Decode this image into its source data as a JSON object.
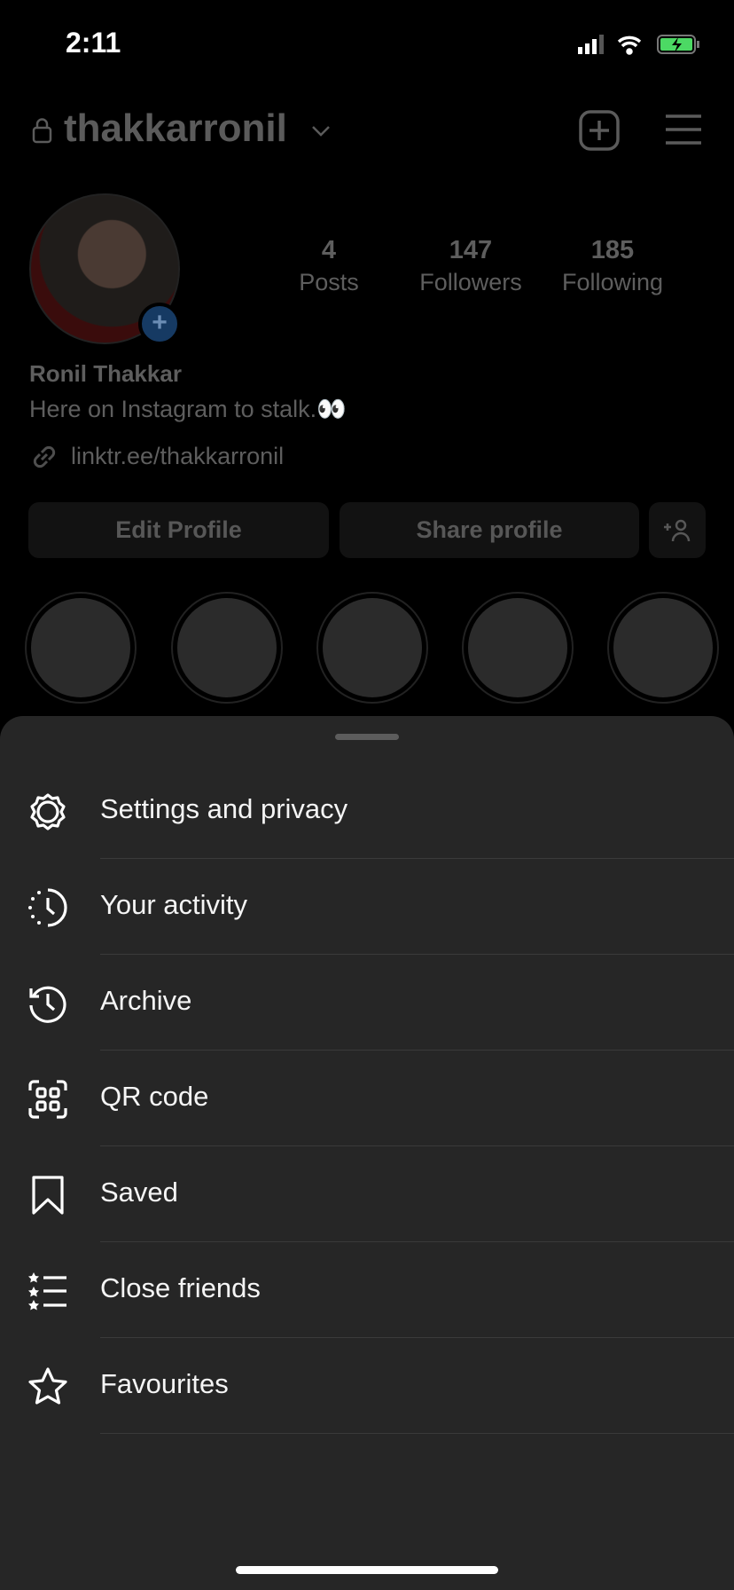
{
  "status_bar": {
    "time": "2:11"
  },
  "header": {
    "username": "thakkarronil"
  },
  "profile": {
    "stats": [
      {
        "value": "4",
        "label": "Posts"
      },
      {
        "value": "147",
        "label": "Followers"
      },
      {
        "value": "185",
        "label": "Following"
      }
    ],
    "name": "Ronil Thakkar",
    "bio": "Here on Instagram to stalk.👀",
    "link": "linktr.ee/thakkarronil",
    "edit_label": "Edit Profile",
    "share_label": "Share profile"
  },
  "menu": {
    "items": [
      {
        "label": "Settings and privacy",
        "icon": "gear-icon"
      },
      {
        "label": "Your activity",
        "icon": "activity-icon"
      },
      {
        "label": "Archive",
        "icon": "archive-icon"
      },
      {
        "label": "QR code",
        "icon": "qr-code-icon"
      },
      {
        "label": "Saved",
        "icon": "bookmark-icon"
      },
      {
        "label": "Close friends",
        "icon": "close-friends-icon"
      },
      {
        "label": "Favourites",
        "icon": "star-icon"
      }
    ]
  },
  "colors": {
    "sheet": "#262626",
    "background": "#000000",
    "battery": "#4cd964"
  }
}
